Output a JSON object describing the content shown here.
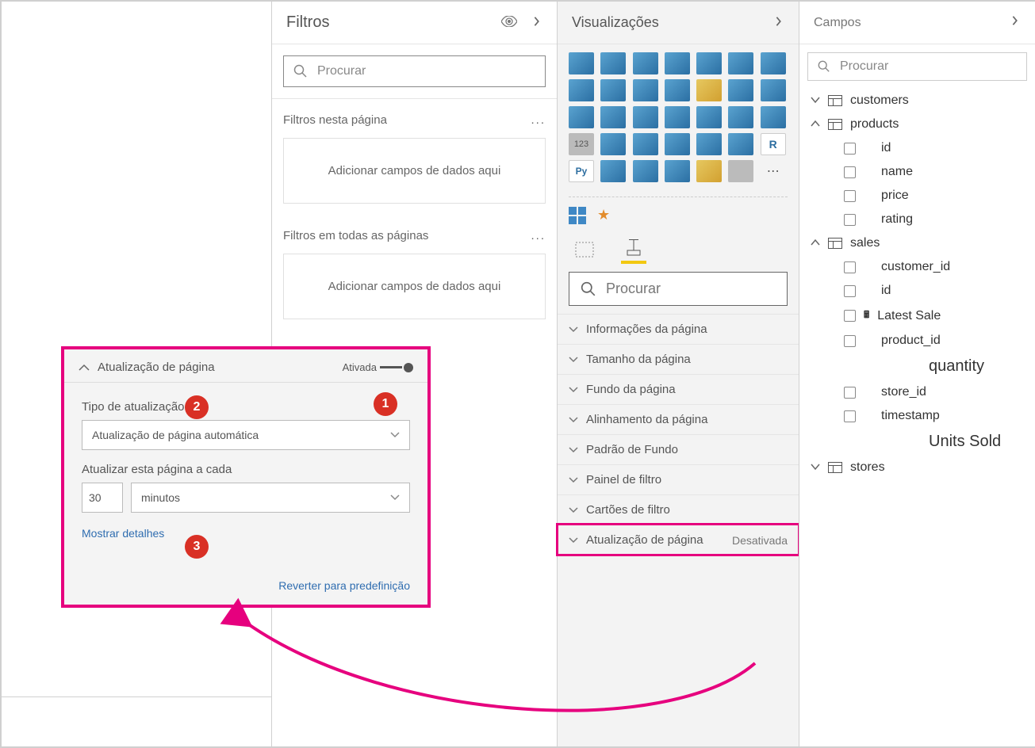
{
  "filters": {
    "title": "Filtros",
    "search_placeholder": "Procurar",
    "section_page": "Filtros nesta página",
    "section_all": "Filtros em todas as páginas",
    "dropzone_text": "Adicionar campos de dados aqui"
  },
  "viz": {
    "title": "Visualizações",
    "search_placeholder": "Procurar",
    "items": [
      {
        "label": "Informações da página"
      },
      {
        "label": "Tamanho da página"
      },
      {
        "label": "Fundo da página"
      },
      {
        "label": "Alinhamento da página"
      },
      {
        "label": "Padrão de Fundo"
      },
      {
        "label": "Painel de filtro"
      },
      {
        "label": "Cartões de filtro"
      },
      {
        "label": "Atualização de página",
        "status": "Desativada",
        "highlight": true
      }
    ]
  },
  "fields": {
    "title": "Campos",
    "search_placeholder": "Procurar",
    "tables": [
      {
        "name": "customers",
        "expanded": false,
        "fields": []
      },
      {
        "name": "products",
        "expanded": true,
        "fields": [
          {
            "name": "id"
          },
          {
            "name": "name"
          },
          {
            "name": "price"
          },
          {
            "name": "rating"
          }
        ]
      },
      {
        "name": "sales",
        "expanded": true,
        "fields": [
          {
            "name": "customer_id"
          },
          {
            "name": "id"
          },
          {
            "name": "Latest Sale",
            "calc": true
          },
          {
            "name": "product_id"
          },
          {
            "name": "quantity",
            "nocb": true,
            "indent": true
          },
          {
            "name": "store_id"
          },
          {
            "name": "timestamp"
          },
          {
            "name": "Units Sold",
            "nocb": true,
            "indent": true
          }
        ]
      },
      {
        "name": "stores",
        "expanded": false,
        "fields": []
      }
    ]
  },
  "callout": {
    "header": "Atualização de página",
    "toggle_label": "Ativada",
    "type_label": "Tipo de atualização",
    "type_value": "Atualização de página automática",
    "interval_label": "Atualizar esta página a cada",
    "interval_value": "30",
    "interval_unit": "minutos",
    "show_details": "Mostrar detalhes",
    "revert": "Reverter para predefinição",
    "badges": {
      "b1": "1",
      "b2": "2",
      "b3": "3"
    }
  }
}
